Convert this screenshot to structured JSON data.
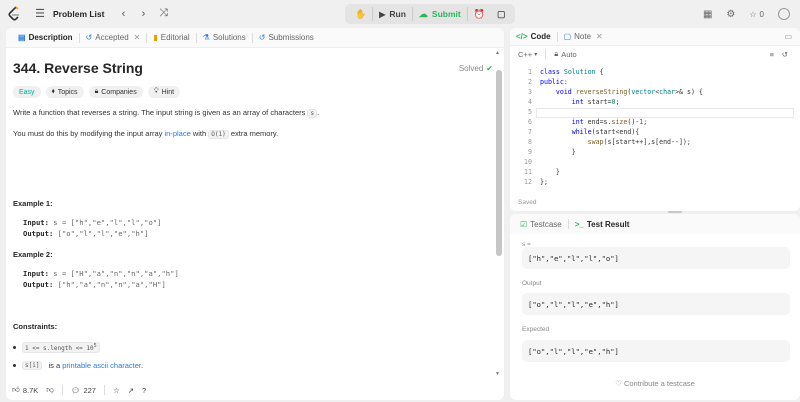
{
  "nav": {
    "title": "Problem List",
    "run": "Run",
    "submit": "Submit",
    "count": "0"
  },
  "left_tabs": [
    {
      "label": "Description"
    },
    {
      "label": "Accepted"
    },
    {
      "label": "Editorial"
    },
    {
      "label": "Solutions"
    },
    {
      "label": "Submissions"
    }
  ],
  "problem": {
    "title": "344. Reverse String",
    "status": "Solved",
    "tags": [
      "Easy",
      "Topics",
      "Companies",
      "Hint"
    ],
    "p1_a": "Write a function that reverses a string. The input string is given as an array of characters",
    "p1_code": "s",
    "p1_b": ".",
    "p2_a": "You must do this by modifying the input array",
    "p2_link": "in-place",
    "p2_b": "with",
    "p2_code": "O(1)",
    "p2_c": "extra memory.",
    "ex1_head": "Example 1:",
    "ex1_in_label": "Input:",
    "ex1_in": "s = [\"h\",\"e\",\"l\",\"l\",\"o\"]",
    "ex1_out_label": "Output:",
    "ex1_out": "[\"o\",\"l\",\"l\",\"e\",\"h\"]",
    "ex2_head": "Example 2:",
    "ex2_in_label": "Input:",
    "ex2_in": "s = [\"H\",\"a\",\"n\",\"n\",\"a\",\"h\"]",
    "ex2_out_label": "Output:",
    "ex2_out": "[\"h\",\"a\",\"n\",\"n\",\"a\",\"H\"]",
    "constraints_head": "Constraints:",
    "c1_code": "1 <= s.length <= 10",
    "c1_sup": "5",
    "c2_code": "s[i]",
    "c2_a": "is a",
    "c2_link": "printable ascii character",
    "c2_b": "."
  },
  "footer": {
    "likes": "8.7K",
    "comments": "227"
  },
  "code_tabs": [
    {
      "label": "Code"
    },
    {
      "label": "Note"
    }
  ],
  "lang": {
    "language": "C++",
    "mode": "Auto"
  },
  "code_lines": [
    "class Solution {",
    "public:",
    "    void reverseString(vector<char>& s) {",
    "        int start=0;",
    "",
    "        int end=s.size()-1;",
    "        while(start<end){",
    "            swap(s[start++],s[end--]);",
    "        }",
    "",
    "    }",
    "};"
  ],
  "saved": "Saved",
  "test_tabs": [
    {
      "label": "Testcase"
    },
    {
      "label": "Test Result"
    }
  ],
  "result": {
    "input_label": "s =",
    "input": "[\"h\",\"e\",\"l\",\"l\",\"o\"]",
    "output_label": "Output",
    "output": "[\"o\",\"l\",\"l\",\"e\",\"h\"]",
    "expected_label": "Expected",
    "expected": "[\"o\",\"l\",\"l\",\"e\",\"h\"]",
    "contribute": "Contribute a testcase"
  },
  "colors": {
    "accent_green": "#2db55d",
    "easy": "#00af9b",
    "link": "#2a7ae2"
  }
}
